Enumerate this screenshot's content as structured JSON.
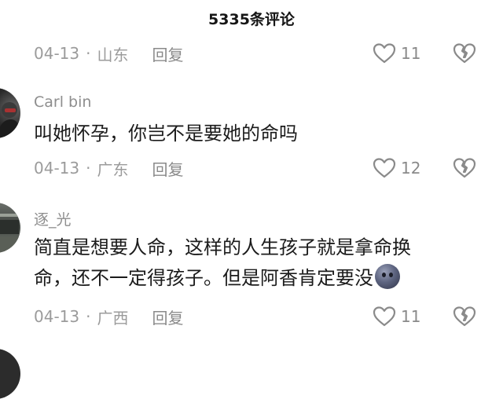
{
  "header": {
    "title": "5335条评论"
  },
  "top_meta": {
    "date": "04-13",
    "separator": "·",
    "location": "山东",
    "reply": "回复",
    "likes": "11"
  },
  "comments": [
    {
      "username": "Carl bin",
      "text": "叫她怀孕，你岂不是要她的命吗",
      "date": "04-13",
      "separator": "·",
      "location": "广东",
      "reply": "回复",
      "likes": "12"
    },
    {
      "username": "逐_光",
      "text_line1": "简直是想要人命，这样的人生孩子就是拿命换",
      "text_line2": "命，还不一定得孩子。但是阿香肯定要没",
      "emoji": "dark-moon-face-emoji",
      "date": "04-13",
      "separator": "·",
      "location": "广西",
      "reply": "回复",
      "likes": "11"
    }
  ],
  "icons": {
    "like": "heart-outline-icon",
    "dislike": "broken-heart-icon"
  },
  "colors": {
    "meta_text": "#9b9b9b",
    "body_text": "#1b1b1b",
    "icon_stroke": "#8a8a8a"
  }
}
